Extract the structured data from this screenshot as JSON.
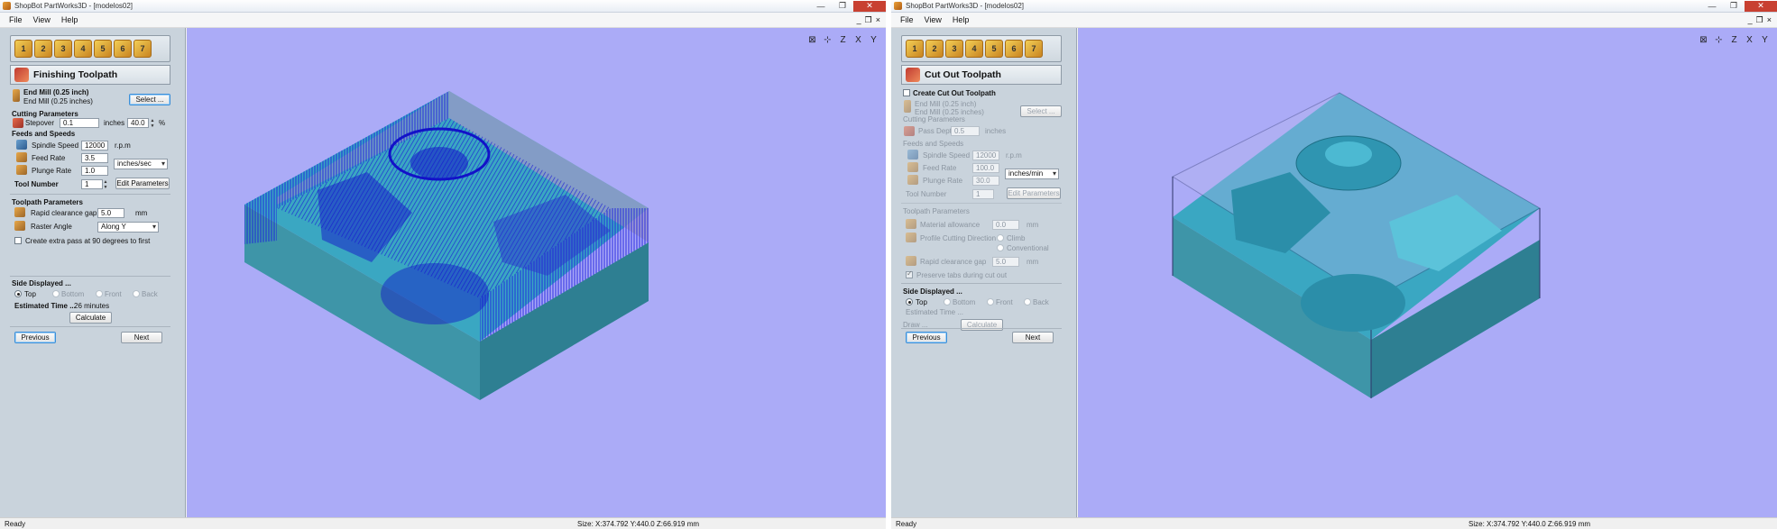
{
  "app": {
    "title": "ShopBot PartWorks3D - [modelos02]",
    "menu": [
      "File",
      "View",
      "Help"
    ],
    "window_buttons": [
      "—",
      "❐",
      "✕"
    ],
    "mdi_buttons": [
      "_",
      "❐",
      "×"
    ]
  },
  "left": {
    "step_labels": [
      "1",
      "2",
      "3",
      "4",
      "5",
      "6",
      "7"
    ],
    "header": "Finishing Toolpath",
    "tool_name": "End Mill (0.25 inch)",
    "tool_name_sub": "End Mill (0.25 inches)",
    "select_button": "Select ...",
    "cutting_params": "Cutting Parameters",
    "stepover_label": "Stepover",
    "stepover_value": "0.1",
    "stepover_units": "inches",
    "stepover_percent": "40.0",
    "percent_sign": "%",
    "feeds_speeds": "Feeds and Speeds",
    "spindle_label": "Spindle Speed",
    "spindle_value": "12000",
    "spindle_units": "r.p.m",
    "feed_label": "Feed Rate",
    "feed_value": "3.5",
    "feed_units": "inches/sec",
    "plunge_label": "Plunge Rate",
    "plunge_value": "1.0",
    "tool_number_label": "Tool Number",
    "tool_number_value": "1",
    "edit_params": "Edit Parameters",
    "toolpath_params": "Toolpath Parameters",
    "rapid_label": "Rapid clearance gap",
    "rapid_value": "5.0",
    "rapid_units": "mm",
    "raster_label": "Raster Angle",
    "raster_value": "Along Y",
    "extra_pass": "Create extra pass at 90 degrees to first",
    "side_displayed": "Side Displayed ...",
    "sides": [
      "Top",
      "Bottom",
      "Front",
      "Back"
    ],
    "estimated_label": "Estimated Time ...",
    "estimated_value": "26 minutes",
    "calculate": "Calculate",
    "previous": "Previous",
    "next": "Next",
    "status_ready": "Ready",
    "status_size": "Size: X:374.792 Y:440.0 Z:66.919 mm"
  },
  "right": {
    "step_labels": [
      "1",
      "2",
      "3",
      "4",
      "5",
      "6",
      "7"
    ],
    "header": "Cut Out Toolpath",
    "create_cutout": "Create Cut Out Toolpath",
    "tool_name": "End Mill (0.25 inch)",
    "tool_name_sub": "End Mill (0.25 inches)",
    "select_button": "Select ...",
    "cutting_params": "Cutting Parameters",
    "pass_depth_label": "Pass Depth",
    "pass_depth_value": "0.5",
    "pass_depth_units": "inches",
    "feeds_speeds": "Feeds and Speeds",
    "spindle_label": "Spindle Speed",
    "spindle_value": "12000",
    "spindle_units": "r.p.m",
    "feed_label": "Feed Rate",
    "feed_value": "100.0",
    "feed_units": "inches/min",
    "plunge_label": "Plunge Rate",
    "plunge_value": "30.0",
    "tool_number_label": "Tool Number",
    "tool_number_value": "1",
    "edit_params": "Edit Parameters",
    "toolpath_params": "Toolpath Parameters",
    "allowance_label": "Material allowance",
    "allowance_value": "0.0",
    "allowance_units": "mm",
    "direction_label": "Profile Cutting Direction",
    "climb": "Climb",
    "conventional": "Conventional",
    "rapid_label": "Rapid clearance gap",
    "rapid_value": "5.0",
    "rapid_units": "mm",
    "preserve_tabs": "Preserve tabs during cut out",
    "side_displayed": "Side Displayed ...",
    "sides": [
      "Top",
      "Bottom",
      "Front",
      "Back"
    ],
    "estimated_label": "Estimated Time ...",
    "draw_label": "Draw ...",
    "calculate": "Calculate",
    "previous": "Previous",
    "next": "Next",
    "status_ready": "Ready",
    "status_size": "Size: X:374.792 Y:440.0 Z:66.919 mm"
  },
  "view_tool_icons": [
    "fit-view-icon",
    "iso-view-icon",
    "view-z-icon",
    "view-x-icon",
    "view-y-icon"
  ],
  "colors": {
    "viewport_bg": "#ababf7",
    "panel_bg": "#c9d3dc",
    "toolpath_blue": "#1a1ae0",
    "model_cyan": "#3aa7c2"
  }
}
